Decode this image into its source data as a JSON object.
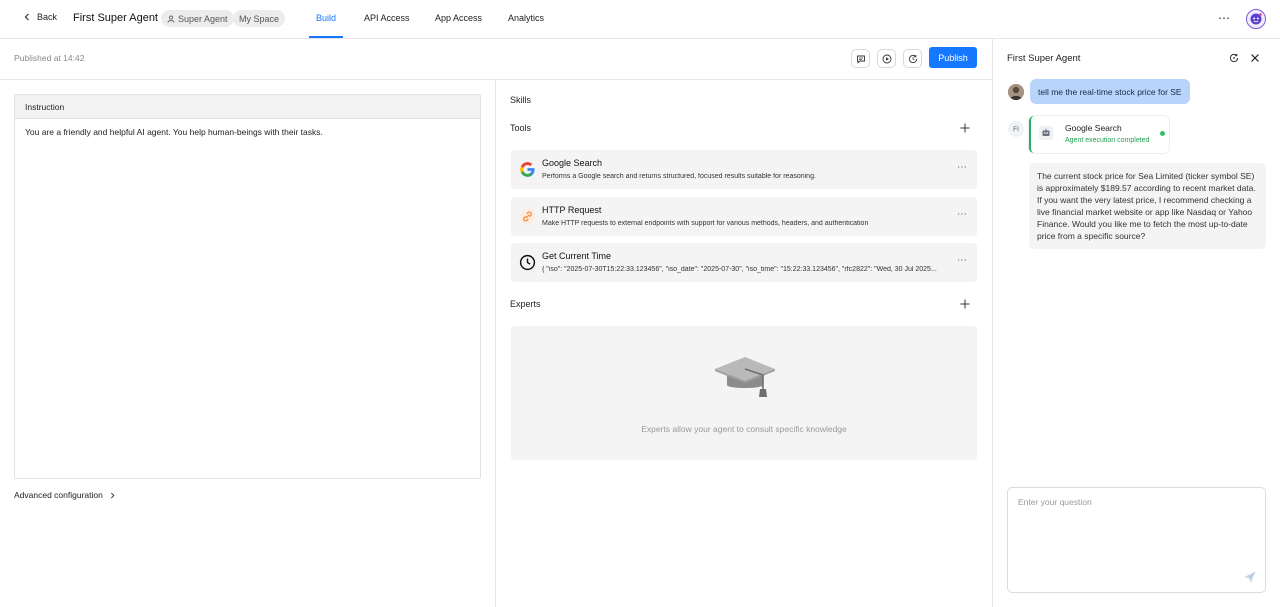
{
  "topbar": {
    "back_label": "Back",
    "agent_name": "First Super Agent",
    "badges": [
      "Super Agent",
      "My Space"
    ],
    "tabs": [
      {
        "label": "Build",
        "active": true
      },
      {
        "label": "API Access",
        "active": false
      },
      {
        "label": "App Access",
        "active": false
      },
      {
        "label": "Analytics",
        "active": false
      }
    ],
    "accent_color": "#1677ff"
  },
  "pubbar": {
    "published_text": "Published at 14:42",
    "publish_label": "Publish",
    "icons": [
      "message-icon",
      "play-icon",
      "history-icon"
    ]
  },
  "instruction": {
    "header": "Instruction",
    "text": "You are a friendly and helpful AI agent. You help human-beings with their tasks."
  },
  "advanced": {
    "label": "Advanced configuration"
  },
  "skills": {
    "label": "Skills",
    "tools_label": "Tools",
    "tools": [
      {
        "name": "Google Search",
        "description": "Performs a Google search and returns structured, focused results suitable for reasoning.",
        "icon": "google-icon"
      },
      {
        "name": "HTTP Request",
        "description": "Make HTTP requests to external endpoints with support for various methods, headers, and authentication",
        "icon": "link-icon"
      },
      {
        "name": "Get Current Time",
        "description": "{ \"iso\": \"2025-07-30T15:22:33.123456\", \"iso_date\": \"2025-07-30\", \"iso_time\": \"15:22:33.123456\", \"rfc2822\": \"Wed, 30 Jul 2025...",
        "icon": "clock-icon"
      }
    ],
    "experts_label": "Experts",
    "experts_empty_text": "Experts allow your agent to consult specific knowledge"
  },
  "chat": {
    "title": "First Super Agent",
    "user_message": "tell me the real-time stock price for SE",
    "bot_avatar_text": "FI",
    "execution": {
      "tool_name": "Google Search",
      "status": "Agent execution completed",
      "status_color": "#22a055"
    },
    "answer": "The current stock price for Sea Limited (ticker symbol SE) is approximately $189.57 according to recent market data. If you want the very latest price, I recommend checking a live financial market website or app like Nasdaq or Yahoo Finance. Would you like me to fetch the most up-to-date price from a specific source?",
    "input_placeholder": "Enter your question",
    "input_value": ""
  }
}
